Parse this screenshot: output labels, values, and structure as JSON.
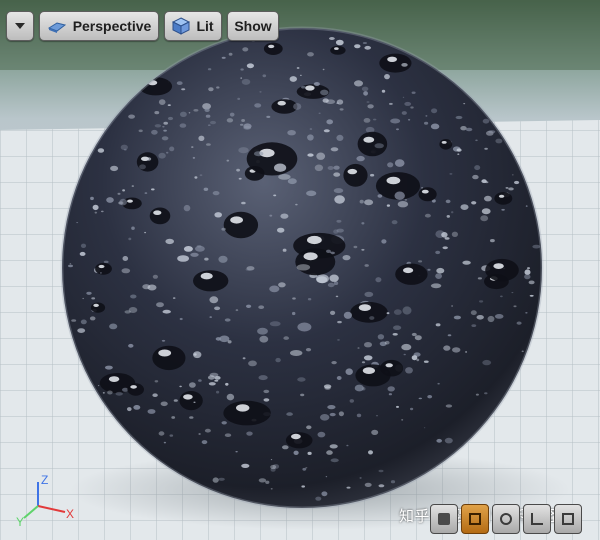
{
  "toolbar": {
    "menu_icon": "chevron-down-icon",
    "view_mode": {
      "label": "Perspective",
      "icon": "perspective-cube-icon"
    },
    "lighting": {
      "label": "Lit",
      "icon": "lit-cube-icon"
    },
    "show": {
      "label": "Show"
    }
  },
  "axis_gizmo": {
    "x_label": "X",
    "y_label": "Y",
    "z_label": "Z",
    "x_color": "#e23a3a",
    "y_color": "#5fd36b",
    "z_color": "#3f74e6"
  },
  "watermark": {
    "text": "知乎 @樱桃小嘴拆拆怪"
  },
  "viewport_buttons": [
    {
      "icon": "camera-icon",
      "active": false
    },
    {
      "icon": "grid-snap-icon",
      "active": true
    },
    {
      "icon": "rotate-icon",
      "active": false
    },
    {
      "icon": "scale-icon",
      "active": false
    },
    {
      "icon": "layout-icon",
      "active": false
    }
  ],
  "colors": {
    "accent_active": "#c47a1f",
    "sphere": "#2b2f3d",
    "floor": "#e4e9ec"
  }
}
